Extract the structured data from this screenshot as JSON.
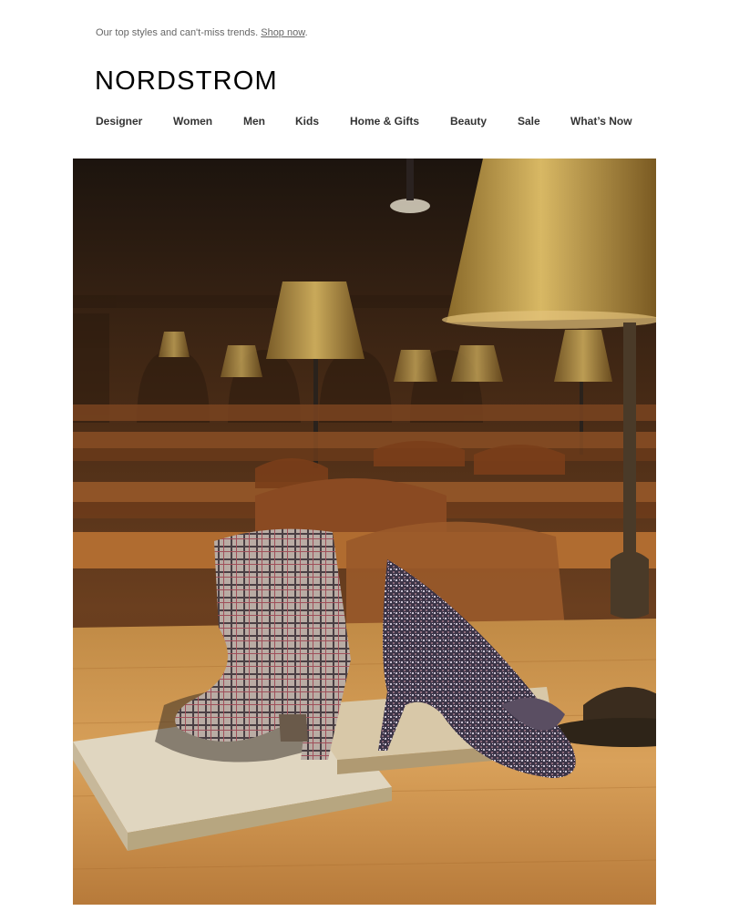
{
  "preheader": {
    "text": "Our top styles and can't-miss trends.",
    "link_label": "Shop now",
    "trailing": "."
  },
  "brand": {
    "logo_text": "NORDSTROM"
  },
  "nav": {
    "items": [
      {
        "label": "Designer"
      },
      {
        "label": "Women"
      },
      {
        "label": "Men"
      },
      {
        "label": "Kids"
      },
      {
        "label": "Home & Gifts"
      },
      {
        "label": "Beauty"
      },
      {
        "label": "Sale"
      },
      {
        "label": "What’s Now"
      }
    ]
  },
  "hero": {
    "image_subject": "plaid-bootie-and-tweed-pump-on-library-table"
  },
  "colors": {
    "text_dark": "#333333",
    "text_muted": "#666666",
    "brand_black": "#000000"
  }
}
